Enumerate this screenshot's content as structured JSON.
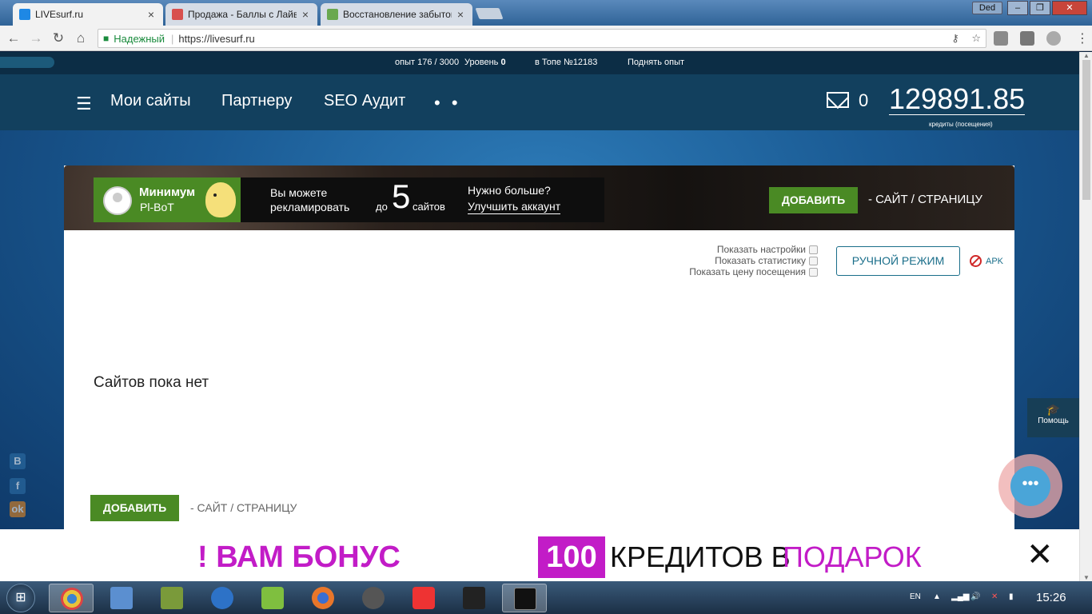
{
  "browser": {
    "tabs": [
      {
        "label": "LIVEsurf.ru",
        "active": true,
        "fav_color": "#1e88e5"
      },
      {
        "label": "Продажа - Баллы с Лайвс",
        "active": false,
        "fav_color": "#d8504e"
      },
      {
        "label": "Восстановление забытого",
        "active": false,
        "fav_color": "#6aa84f"
      }
    ],
    "user": "Ded",
    "secure_label": "Надежный",
    "url": "https://livesurf.ru"
  },
  "topstrip": {
    "exp_label": "опыт",
    "exp_value": "176 / 3000",
    "level_label": "Уровень",
    "level_value": "0",
    "top_label": "в Топе №",
    "top_value": "12183",
    "raise": "Поднять опыт"
  },
  "nav": {
    "items": [
      "Мои сайты",
      "Партнеру",
      "SEO Аудит"
    ],
    "more": "• •",
    "mail_count": "0",
    "balance": "129891.85",
    "balance_label": "кредиты (посещения)"
  },
  "plan": {
    "name": "Минимум",
    "bot": "Pl-BoT",
    "promo_line1": "Вы можете",
    "promo_line2": "рекламировать",
    "promo_do": "до",
    "promo_num": "5",
    "promo_sites": "сайтов",
    "need_more": "Нужно больше?",
    "upgrade": "Улучшить аккаунт"
  },
  "actions": {
    "add": "ДОБАВИТЬ",
    "add_suffix": "- САЙТ / СТРАНИЦУ",
    "manual": "РУЧНОЙ РЕЖИМ",
    "apk": "APK"
  },
  "options": [
    {
      "label": "Показать настройки"
    },
    {
      "label": "Показать статистику"
    },
    {
      "label": "Показать цену посещения"
    }
  ],
  "empty_text": "Сайтов пока нет",
  "help": {
    "label": "Помощь"
  },
  "banner": {
    "part1": "! ВАМ БОНУС",
    "number": "100",
    "part2": "КРЕДИТОВ В",
    "part3": "ПОДАРОК"
  },
  "social": [
    "В",
    "f",
    "ok"
  ],
  "taskbar": {
    "lang": "EN",
    "time": "15:26",
    "apps": [
      {
        "name": "chrome",
        "color": "#e8c33a"
      },
      {
        "name": "computer",
        "color": "#5b8fd0"
      },
      {
        "name": "tool",
        "color": "#7a9a3a"
      },
      {
        "name": "app-c",
        "color": "#2d72c7"
      },
      {
        "name": "bluestacks",
        "color": "#7fbf3f"
      },
      {
        "name": "firefox",
        "color": "#e8762a"
      },
      {
        "name": "network",
        "color": "#555"
      },
      {
        "name": "vivaldi",
        "color": "#e33"
      },
      {
        "name": "console",
        "color": "#222"
      },
      {
        "name": "pw",
        "color": "#111"
      }
    ]
  }
}
